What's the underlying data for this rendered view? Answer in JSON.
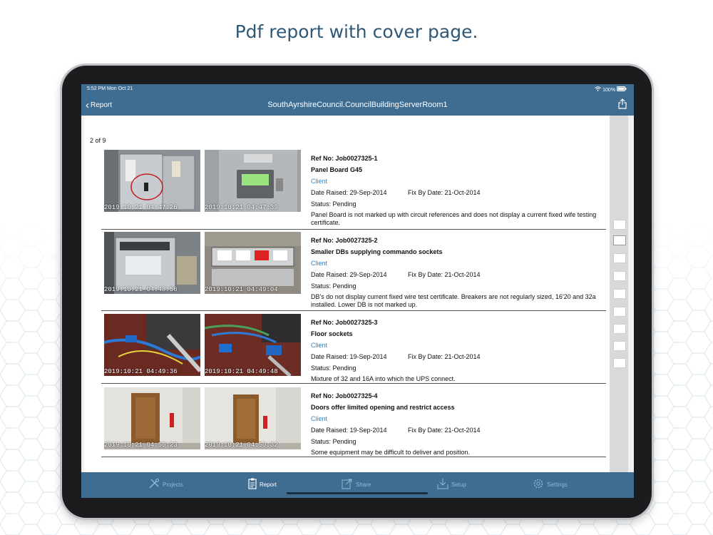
{
  "headline": "Pdf report with cover page.",
  "statusbar": {
    "time": "5:52 PM  Mon Oct 21",
    "battery": "100%"
  },
  "navbar": {
    "back_label": "Report",
    "title": "SouthAyrshireCouncil.CouncilBuildingServerRoom1"
  },
  "page_count": "2 of 9",
  "entries": [
    {
      "ref": "Ref No: Job0027325-1",
      "title": "Panel Board G45",
      "client": "Client",
      "date_raised": "Date Raised: 29-Sep-2014",
      "fix_by": "Fix By Date: 21-Oct-2014",
      "status": "Status: Pending",
      "description": "Panel Board is not marked up with circuit references and does not display a current fixed wife testing certificate.",
      "photo1_ts": "2019:10:21 04:47:26",
      "photo2_ts": "2019:10:21 04:47:39"
    },
    {
      "ref": "Ref No: Job0027325-2",
      "title": "Smaller DBs supplying commando sockets",
      "client": "Client",
      "date_raised": "Date Raised: 29-Sep-2014",
      "fix_by": "Fix By Date: 21-Oct-2014",
      "status": "Status: Pending",
      "description": "DB's do not display current fixed wire test certificate. Breakers are not regularly sized, 16'20 and 32a installed. Lower DB is not marked up.",
      "photo1_ts": "2019:10:21 04:48:56",
      "photo2_ts": "2019:10:21 04:49:04"
    },
    {
      "ref": "Ref No: Job0027325-3",
      "title": "Floor sockets",
      "client": "Client",
      "date_raised": "Date Raised: 19-Sep-2014",
      "fix_by": "Fix By Date: 21-Oct-2014",
      "status": "Status: Pending",
      "description": "Mixture of 32 and 16A into which the UPS connect.",
      "photo1_ts": "2019:10:21 04:49:36",
      "photo2_ts": "2019:10:21 04:49:48"
    },
    {
      "ref": "Ref No: Job0027325-4",
      "title": "Doors offer limited opening and restrict access",
      "client": "Client",
      "date_raised": "Date Raised: 19-Sep-2014",
      "fix_by": "Fix By Date: 21-Oct-2014",
      "status": "Status: Pending",
      "description": "Some equipment may be difficult to deliver and position.",
      "photo1_ts": "2019:10:21 04:50:23",
      "photo2_ts": "2019:10:21 04:50:32"
    }
  ],
  "tabs": {
    "projects": "Projects",
    "report": "Report",
    "share": "Share",
    "setup": "Setup",
    "settings": "Settings"
  },
  "colors": {
    "bar": "#3f6d92",
    "client_link": "#2b86d6",
    "tab_inactive": "#8fb7d6",
    "headline": "#2e5877"
  }
}
